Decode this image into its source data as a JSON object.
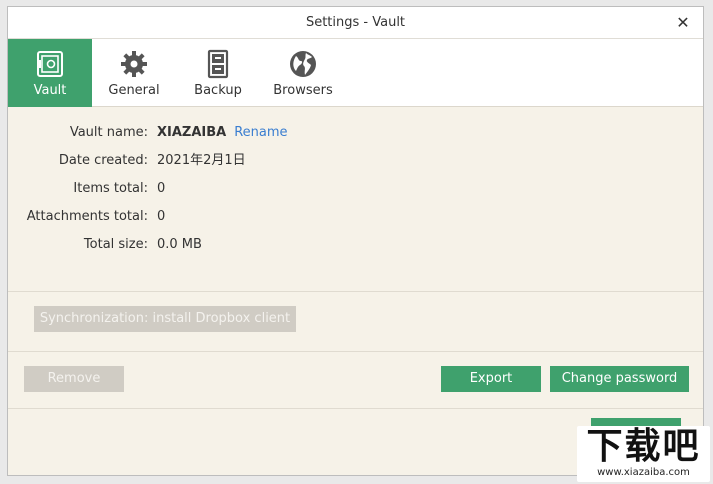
{
  "window": {
    "title": "Settings - Vault"
  },
  "tabs": [
    {
      "label": "Vault",
      "icon": "vault-icon",
      "active": true
    },
    {
      "label": "General",
      "icon": "gear-icon",
      "active": false
    },
    {
      "label": "Backup",
      "icon": "cabinet-icon",
      "active": false
    },
    {
      "label": "Browsers",
      "icon": "globe-icon",
      "active": false
    }
  ],
  "vault": {
    "name_label": "Vault name:",
    "name_value": "XIAZAIBA",
    "rename_link": "Rename",
    "date_label": "Date created:",
    "date_value": "2021年2月1日",
    "items_label": "Items total:",
    "items_value": "0",
    "attachments_label": "Attachments total:",
    "attachments_value": "0",
    "size_label": "Total size:",
    "size_value": "0.0 MB"
  },
  "sync": {
    "button_label": "Synchronization: install Dropbox client"
  },
  "actions": {
    "remove_label": "Remove",
    "export_label": "Export",
    "change_password_label": "Change password"
  },
  "watermark": {
    "logo_text": "下载吧",
    "url_text": "www.xiazaiba.com"
  },
  "colors": {
    "accent": "#3fa16d",
    "link": "#3a7ed0",
    "disabled": "#d0ccc4",
    "panel": "#f6f2e8"
  }
}
